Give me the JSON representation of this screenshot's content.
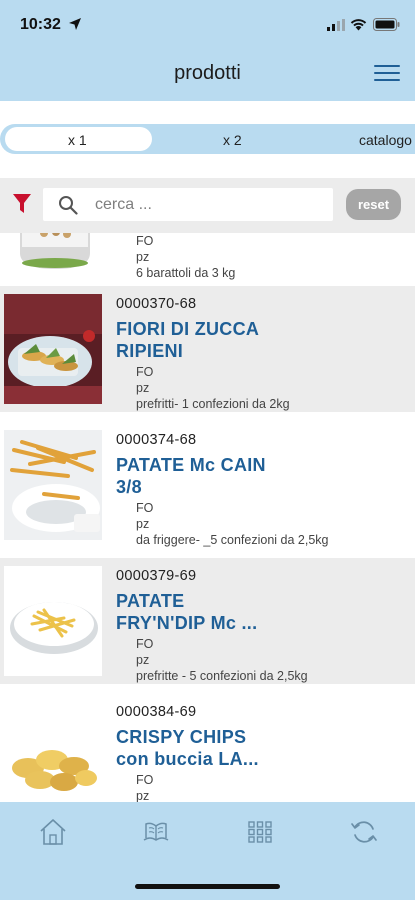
{
  "status_bar": {
    "time": "10:32"
  },
  "header": {
    "title": "prodotti"
  },
  "tabs": [
    {
      "label": "x 1",
      "active": true
    },
    {
      "label": "x 2",
      "active": false
    },
    {
      "label": "catalogo",
      "active": false
    }
  ],
  "filter": {
    "search_placeholder": "cerca ...",
    "reset_label": "reset"
  },
  "products": [
    {
      "code": "",
      "name": [],
      "meta": [
        "FO",
        "pz",
        "6 barattoli da 3 kg"
      ]
    },
    {
      "code": "0000370-68",
      "name": [
        "FIORI DI ZUCCA",
        "RIPIENI"
      ],
      "meta": [
        "FO",
        "pz",
        "prefritti- 1 confezioni da 2kg"
      ]
    },
    {
      "code": "0000374-68",
      "name": [
        "PATATE Mc CAIN",
        "3/8"
      ],
      "meta": [
        "FO",
        "pz",
        "da friggere- _5 confezioni da 2,5kg"
      ]
    },
    {
      "code": "0000379-69",
      "name": [
        "PATATE",
        "FRY'N'DIP Mc ..."
      ],
      "meta": [
        "FO",
        "pz",
        "prefritte - 5 confezioni da 2,5kg"
      ]
    },
    {
      "code": "0000384-69",
      "name": [
        "CRISPY CHIPS",
        "con buccia LA..."
      ],
      "meta": [
        "FO",
        "pz"
      ]
    }
  ],
  "tabbar": [
    {
      "icon": "home-icon"
    },
    {
      "icon": "catalog-book-icon"
    },
    {
      "icon": "grid-icon"
    },
    {
      "icon": "sync-icon"
    }
  ],
  "colors": {
    "header_bg": "#b9dbf0",
    "accent": "#1f5f96",
    "filter_red": "#c8102e"
  }
}
